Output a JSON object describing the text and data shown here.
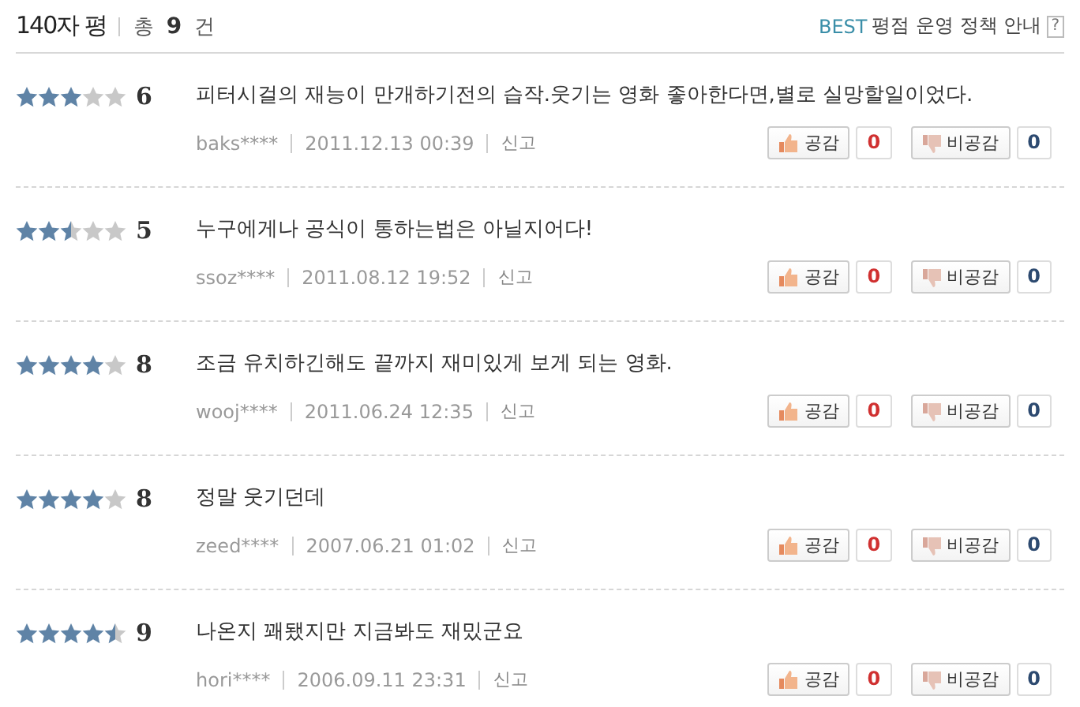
{
  "header": {
    "title": "140자 평",
    "total_label": "총",
    "total_count": "9",
    "total_unit": "건",
    "policy_badge": "BEST",
    "policy_link": "평점 운영 정책 안내",
    "help": "?"
  },
  "reviews": [
    {
      "stars": 3,
      "score": "6",
      "comment": "피터시걸의 재능이 만개하기전의 습작.웃기는 영화 좋아한다면,별로 실망할일이었다.",
      "user": "baks****",
      "date": "2011.12.13 00:39",
      "report": "신고",
      "like_label": "공감",
      "likes": "0",
      "dislike_label": "비공감",
      "dislikes": "0"
    },
    {
      "stars": 2.5,
      "score": "5",
      "comment": "누구에게나 공식이 통하는법은 아닐지어다!",
      "user": "ssoz****",
      "date": "2011.08.12 19:52",
      "report": "신고",
      "like_label": "공감",
      "likes": "0",
      "dislike_label": "비공감",
      "dislikes": "0"
    },
    {
      "stars": 4,
      "score": "8",
      "comment": "조금 유치하긴해도 끝까지 재미있게 보게 되는 영화.",
      "user": "wooj****",
      "date": "2011.06.24 12:35",
      "report": "신고",
      "like_label": "공감",
      "likes": "0",
      "dislike_label": "비공감",
      "dislikes": "0"
    },
    {
      "stars": 4,
      "score": "8",
      "comment": "정말 웃기던데",
      "user": "zeed****",
      "date": "2007.06.21 01:02",
      "report": "신고",
      "like_label": "공감",
      "likes": "0",
      "dislike_label": "비공감",
      "dislikes": "0"
    },
    {
      "stars": 4.5,
      "score": "9",
      "comment": "나온지 꽤됐지만 지금봐도 재밌군요",
      "user": "hori****",
      "date": "2006.09.11 23:31",
      "report": "신고",
      "like_label": "공감",
      "likes": "0",
      "dislike_label": "비공감",
      "dislikes": "0"
    }
  ]
}
